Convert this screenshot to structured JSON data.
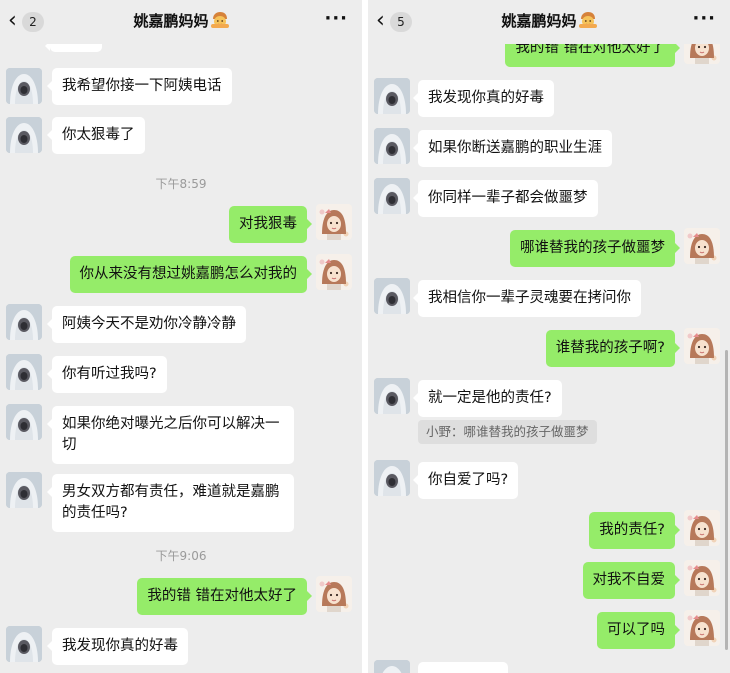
{
  "left": {
    "header": {
      "title": "姚嘉鹏妈妈",
      "badge": "2"
    },
    "messages": {
      "m1": "我希望你接一下阿姨电话",
      "m2": "你太狠毒了",
      "t1": "下午8:59",
      "m3": "对我狠毒",
      "m4": "你从来没有想过姚嘉鹏怎么对我的",
      "m5": "阿姨今天不是劝你冷静冷静",
      "m6": "你有听过我吗?",
      "m7": "如果你绝对曝光之后你可以解决一切",
      "m8": "男女双方都有责任，难道就是嘉鹏的责任吗?",
      "t2": "下午9:06",
      "m9": "我的错 错在对他太好了",
      "m10": "我发现你真的好毒"
    }
  },
  "right": {
    "header": {
      "title": "姚嘉鹏妈妈",
      "badge": "5"
    },
    "messages": {
      "m1": "我的错 错在对他太好了",
      "m2": "我发现你真的好毒",
      "m3": "如果你断送嘉鹏的职业生涯",
      "m4": "你同样一辈子都会做噩梦",
      "m5": "哪谁替我的孩子做噩梦",
      "m6": "我相信你一辈子灵魂要在拷问你",
      "m7": "谁替我的孩子啊?",
      "m8": "就一定是他的责任?",
      "quote": "小野：哪谁替我的孩子做噩梦",
      "m9": "你自爱了吗?",
      "m10": "我的责任?",
      "m11": "对我不自爱",
      "m12": "可以了吗"
    }
  },
  "icons": {
    "back": "chevron-left-icon",
    "more": "more-dots-icon",
    "title_emoji": "face-emoji-icon",
    "avatar_other": "hooded-figure-avatar",
    "avatar_self": "anime-girl-avatar"
  },
  "colors": {
    "background": "#ededed",
    "incoming_bubble": "#ffffff",
    "outgoing_bubble": "#95ec69",
    "timestamp": "#9a9a9a"
  }
}
